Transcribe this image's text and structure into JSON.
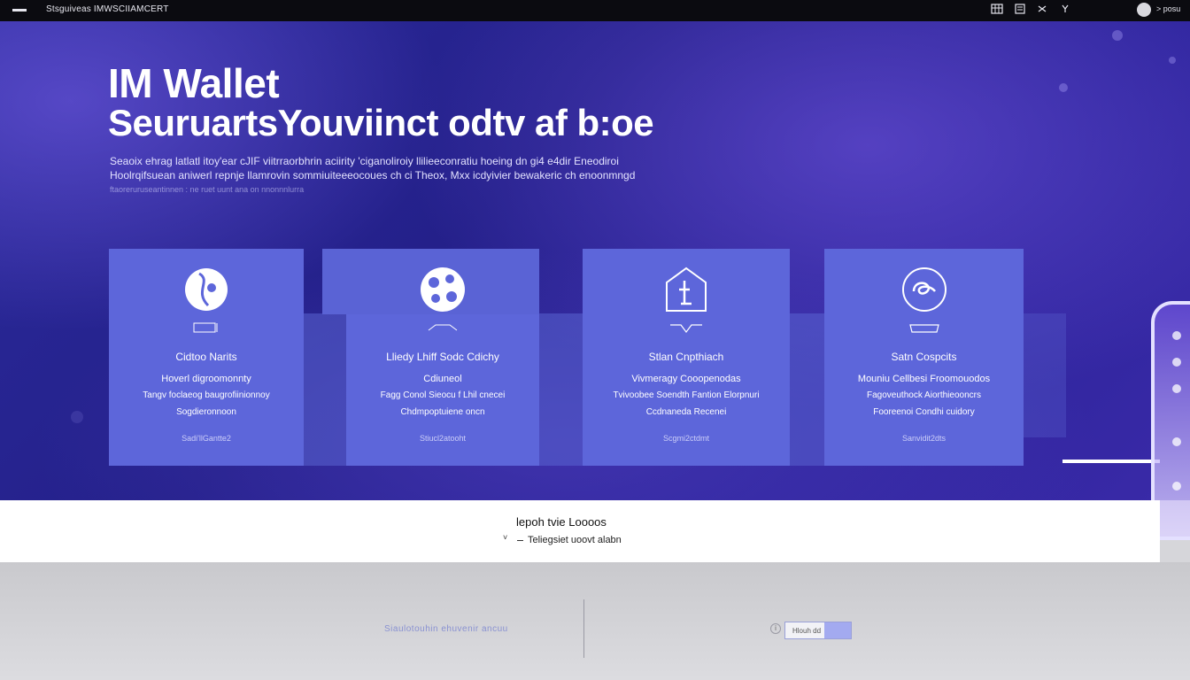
{
  "topbar": {
    "title": "Stsguiveas IMWSCIIAMCERT",
    "right_text": "> posu"
  },
  "hero": {
    "title_line1": "IM Wallet",
    "title_line2": "SeuruartsYouviinct odtv af b:oe",
    "desc_line1": "Seaoix ehrag latlatl itoy'ear cJIF viitrraorbhrin aciirity 'ciganoliroiy llilieeconratiu hoeing dn gi4 e4dir Eneodiroi",
    "desc_line2": "Hoolrqifsuean aniwerl repnje llamrovin sommiuiteeeocoues ch ci Theox, Mxx icdyivier bewakeric ch enoonmngd",
    "desc_line3": "ftaoreruruseantinnen : ne ruet uunt ana on nnonnnlurra"
  },
  "cards": [
    {
      "title": "Cidtoo Narits",
      "subtitle": "Hoverl digroomonnty",
      "line1": "Tangv foclaeog baugrofiinionnoy",
      "line2": "Sogdieronnoon",
      "link": "Sadi'llGantte2"
    },
    {
      "title": "Lliedy Lhiff Sodc Cdichy",
      "subtitle": "Cdiuneol",
      "line1": "Fagg Conol Sieocu f Lhil cnecei",
      "line2": "Chdmpoptuiene oncn",
      "link": "Stiucl2atooht"
    },
    {
      "title": "Stlan Cnpthiach",
      "subtitle": "Vivmeragy Cooopenodas",
      "line1": "Tvivoobee Soendth Fantion Elorpnuri",
      "line2": "Ccdnaneda Recenei",
      "link": "Scgmi2ctdmt"
    },
    {
      "title": "Satn Cospcits",
      "subtitle": "Mouniu Cellbesi Froomouodos",
      "line1": "Fagoveuthock Aiorthieooncrs",
      "line2": "Fooreenoi Condhi cuidory",
      "link": "Sanvidit2dts"
    }
  ],
  "strip": {
    "title": "lepoh tvie Loooos",
    "subtitle": "Teliegsiet uoovt alabn"
  },
  "footer": {
    "blur_text": "Siaulotouhin ehuvenir ancuu",
    "input_text": "Hlouh dd"
  },
  "colors": {
    "hero_bg": "#24208a",
    "card_bg": "#5d66da",
    "topbar_bg": "#0b0b10"
  }
}
